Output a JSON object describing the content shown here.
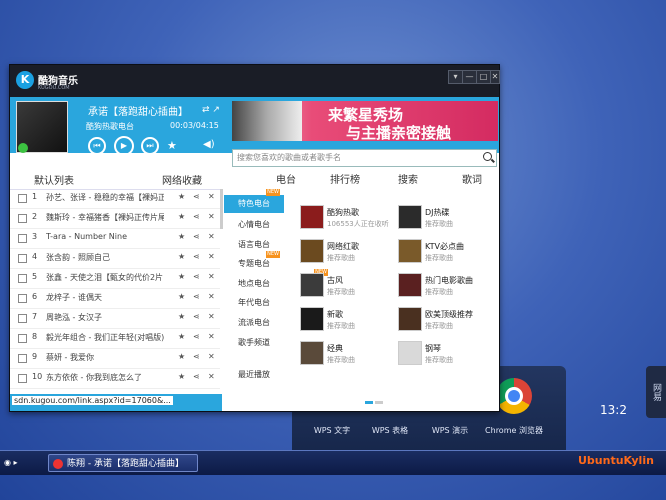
{
  "desktop": {
    "dock_items": [
      "WPS 文字",
      "WPS 表格",
      "WPS 演示",
      "Chrome 浏览器"
    ],
    "side_widget": "网易",
    "clock": "13:2"
  },
  "taskbar": {
    "task_label": "陈翔 - 承诺【落跑甜心插曲】",
    "ubuntu_label": "UbuntuKylin"
  },
  "app": {
    "logo_text": "酷狗音乐",
    "logo_sub": "KUGOU.COM",
    "window_buttons": [
      "▾",
      "—",
      "□",
      "✕"
    ],
    "now_playing": {
      "title": "承诺【落跑甜心插曲】",
      "station": "酷狗热歌电台",
      "time": "00:03/04:15"
    },
    "banner": {
      "line1": "来繁星秀场",
      "line2": "与主播亲密接触"
    },
    "search_placeholder": "搜索您喜欢的歌曲或者歌手名",
    "left_tabs": [
      "默认列表",
      "网络收藏"
    ],
    "songs": [
      {
        "num": "1",
        "name": "孙艺、张译 - 稳稳的幸福【裸妈正"
      },
      {
        "num": "2",
        "name": "魏斯玲 - 幸福猪香【裸妈正传片尾"
      },
      {
        "num": "3",
        "name": "T-ara - Number Nine"
      },
      {
        "num": "4",
        "name": "张含韵 - 照顾自己"
      },
      {
        "num": "5",
        "name": "张鑫 - 天使之泪【甄女的代价2片"
      },
      {
        "num": "6",
        "name": "龙梓子 - 谁偶天"
      },
      {
        "num": "7",
        "name": "周艳泓 - 女汉子"
      },
      {
        "num": "8",
        "name": "毅光年组合 - 我们正年轻(对唱版)"
      },
      {
        "num": "9",
        "name": "蔡妍 - 我爱你"
      },
      {
        "num": "10",
        "name": "东方依依 - 你我到底怎么了"
      }
    ],
    "status_url": "sdn.kugou.com/link.aspx?id=17060&...",
    "right_tabs": [
      "电台",
      "排行榜",
      "搜索",
      "歌词"
    ],
    "categories": [
      "特色电台",
      "心情电台",
      "语言电台",
      "专题电台",
      "地点电台",
      "年代电台",
      "流派电台",
      "歌手频道",
      "最近播放"
    ],
    "new_badge": "NEW",
    "stations": [
      {
        "name": "酷狗热歌",
        "sub": "106553人正在收听"
      },
      {
        "name": "DJ热碟",
        "sub": "推荐歌曲"
      },
      {
        "name": "网络红歌",
        "sub": "推荐歌曲"
      },
      {
        "name": "KTV必点曲",
        "sub": "推荐歌曲"
      },
      {
        "name": "古风",
        "sub": "推荐歌曲"
      },
      {
        "name": "热门电影歌曲",
        "sub": "推荐歌曲"
      },
      {
        "name": "新歌",
        "sub": "推荐歌曲"
      },
      {
        "name": "欧美顶级推荐",
        "sub": "推荐歌曲"
      },
      {
        "name": "经典",
        "sub": "推荐歌曲"
      },
      {
        "name": "钢琴",
        "sub": "推荐歌曲"
      }
    ]
  }
}
